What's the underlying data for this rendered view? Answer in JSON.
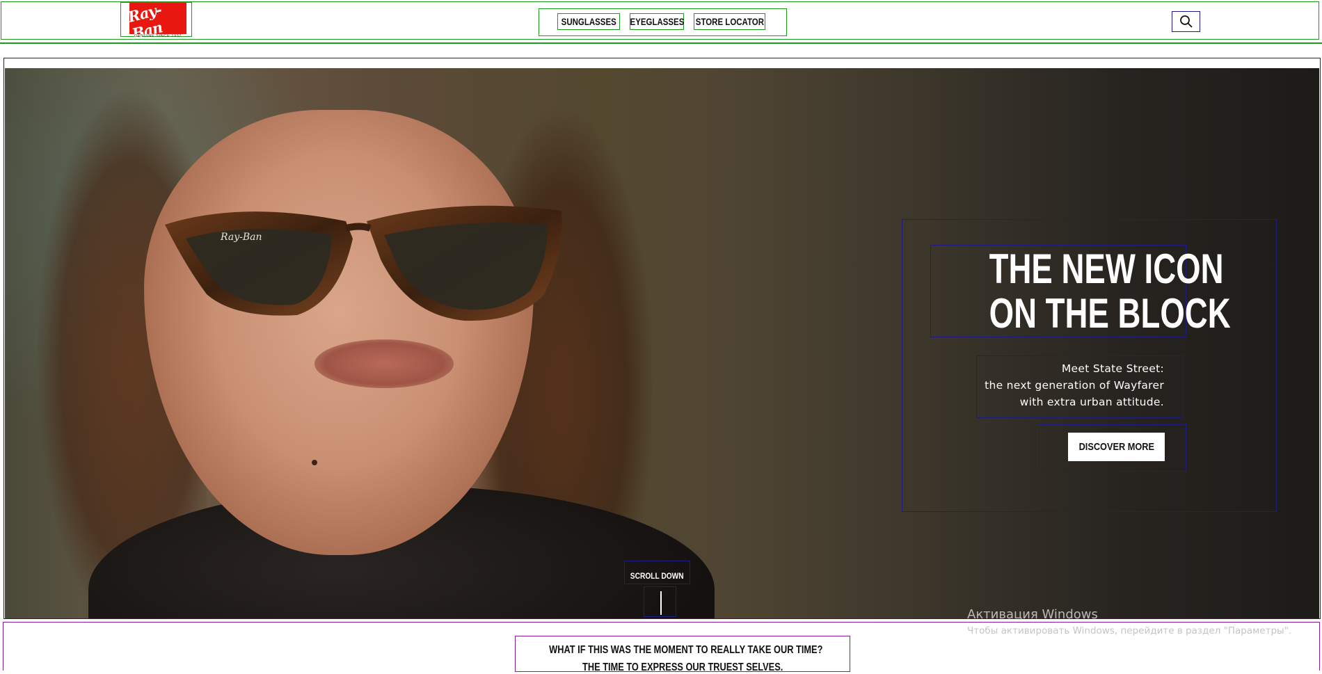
{
  "header": {
    "logo_text": "Ray-Ban",
    "logo_tagline": "GENUINE SINCE 1937",
    "nav": [
      {
        "label": "SUNGLASSES"
      },
      {
        "label": "EYEGLASSES"
      },
      {
        "label": "STORE LOCATOR"
      }
    ],
    "search_icon": "search-icon"
  },
  "hero": {
    "headline_line1": "THE NEW ICON",
    "headline_line2": "ON THE BLOCK",
    "sub_line1": "Meet State Street:",
    "sub_line2": "the next generation of Wayfarer",
    "sub_line3": "with extra urban attitude.",
    "cta_label": "DISCOVER MORE",
    "scroll_label": "SCROLL DOWN"
  },
  "windows_watermark": {
    "title": "Активация Windows",
    "subtitle": "Чтобы активировать Windows, перейдите в раздел \"Параметры\"."
  },
  "intro": {
    "line1": "WHAT IF THIS WAS THE MOMENT TO REALLY TAKE OUR TIME?",
    "line2": "THE TIME TO EXPRESS OUR TRUEST SELVES."
  },
  "colors": {
    "brand_red": "#e8170f",
    "annotation_green": "#1a9c1a",
    "annotation_navy": "#1e1a86",
    "annotation_purple": "#8a1a9c"
  }
}
